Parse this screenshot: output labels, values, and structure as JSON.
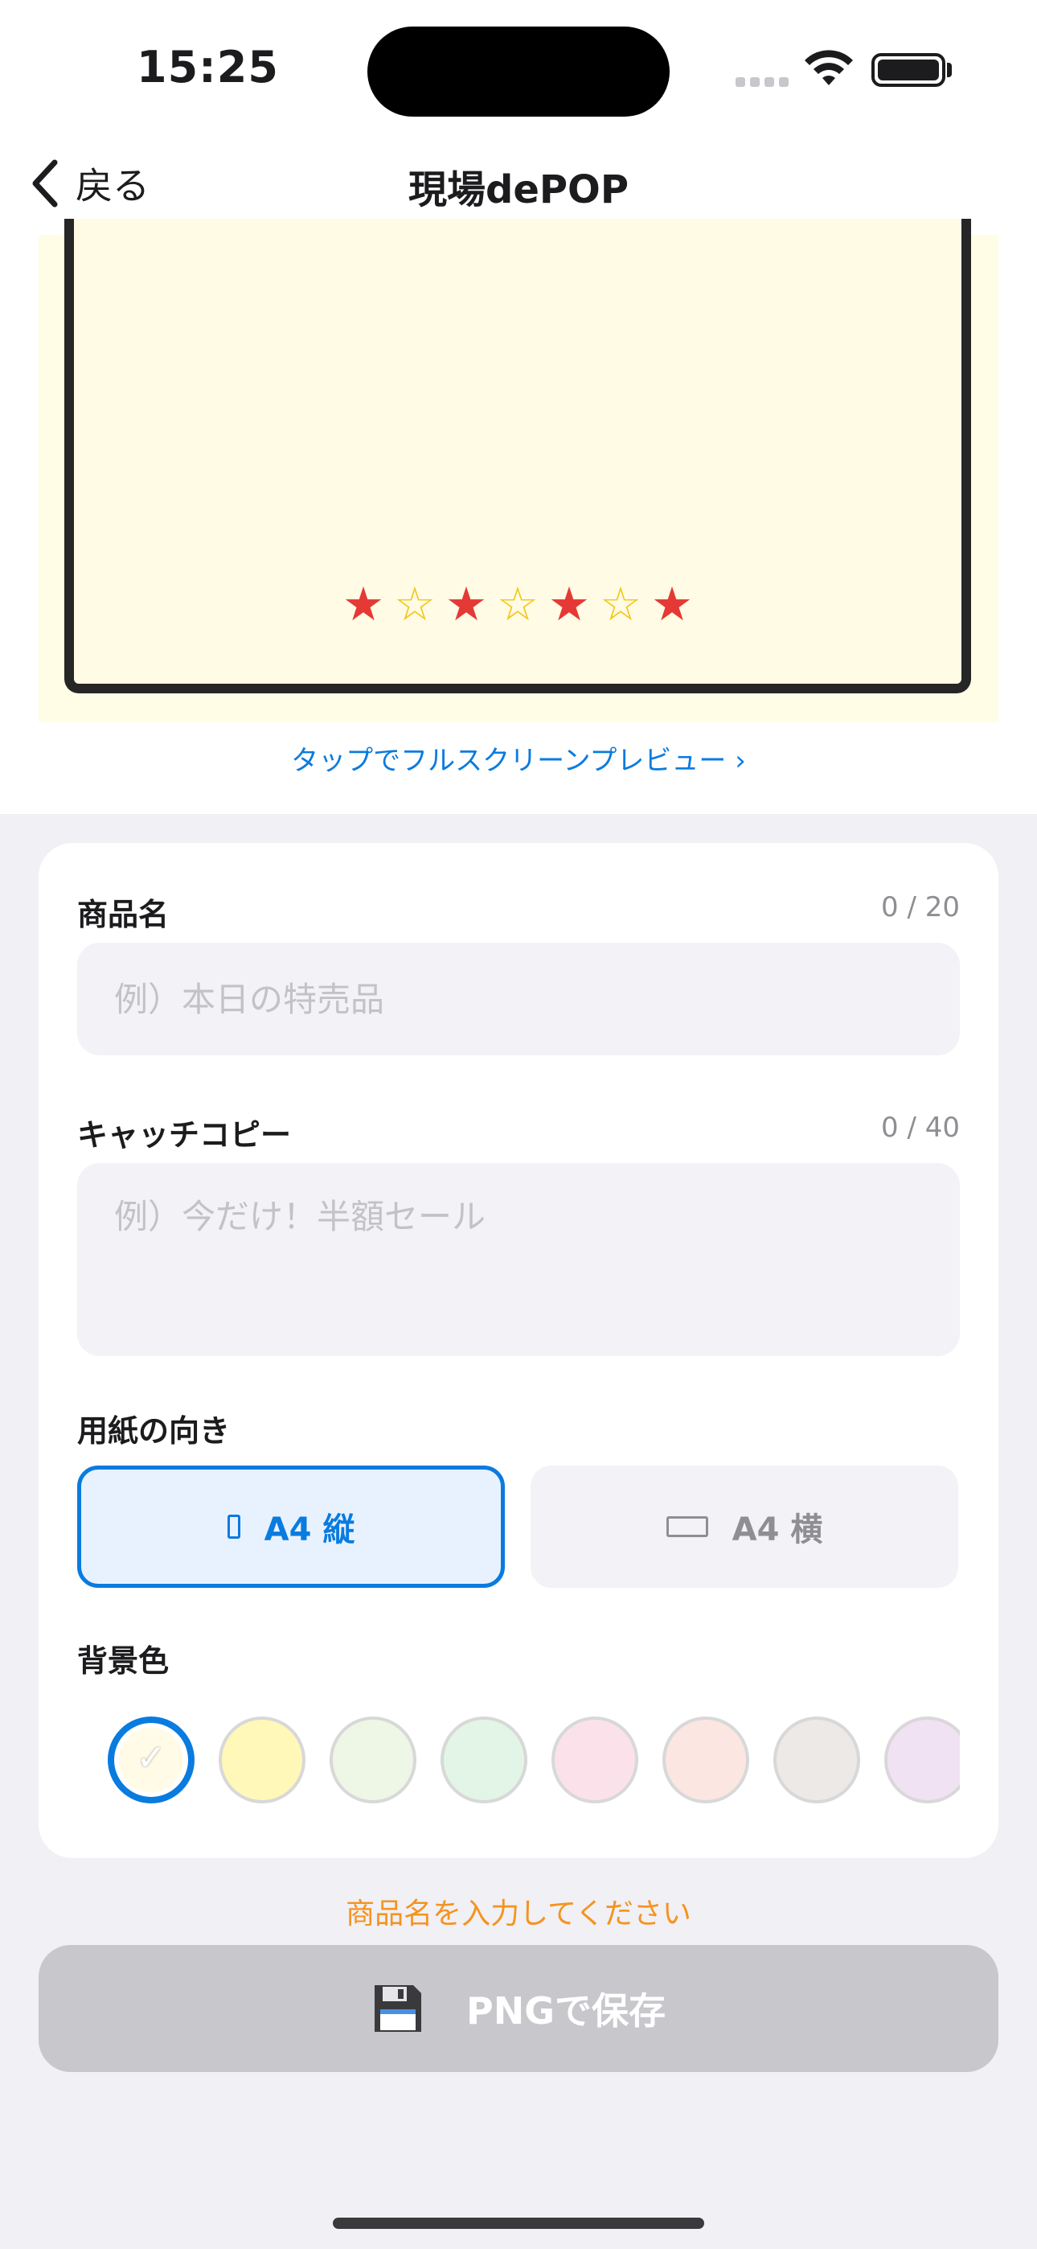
{
  "status_bar": {
    "time": "15:25"
  },
  "nav": {
    "back_label": "戻る",
    "title": "現場dePOP"
  },
  "preview": {
    "stars": [
      "filled",
      "outline",
      "filled",
      "outline",
      "filled",
      "outline",
      "filled"
    ],
    "link_text": "タップでフルスクリーンプレビュー ›",
    "colors": {
      "background": "#fffde6",
      "poster": "#fffbe4",
      "frame": "#262626"
    }
  },
  "form": {
    "product_name": {
      "label": "商品名",
      "count": "0 / 20",
      "value": "",
      "placeholder": "例）本日の特売品"
    },
    "catch_copy": {
      "label": "キャッチコピー",
      "count": "0 / 40",
      "value": "",
      "placeholder": "例）今だけ！半額セール"
    },
    "orientation": {
      "label": "用紙の向き",
      "options": [
        {
          "label": "A4 縦",
          "icon": "portrait-page-icon",
          "selected": true
        },
        {
          "label": "A4 横",
          "icon": "landscape-page-icon",
          "selected": false
        }
      ]
    },
    "background_color": {
      "label": "背景色",
      "selected_index": 0,
      "swatches": [
        "#fffbe6",
        "#fff8b8",
        "#eef7e6",
        "#e2f5e6",
        "#fbe2ea",
        "#fbe6e2",
        "#ece9e7",
        "#f0e2f2"
      ]
    }
  },
  "validation_message": "商品名を入力してください",
  "save_button": {
    "label": "PNGで保存",
    "icon": "floppy-disk-icon",
    "enabled": false
  },
  "colors": {
    "accent": "#0a7bdf",
    "warning": "#f5931e",
    "disabled": "#c7c7cc"
  }
}
